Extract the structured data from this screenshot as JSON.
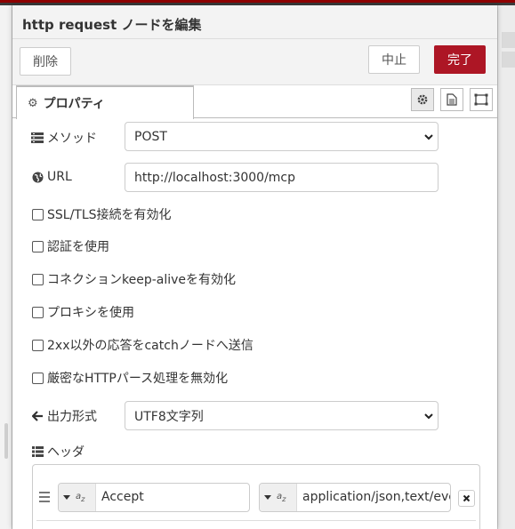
{
  "dialog": {
    "title": "http request ノードを編集",
    "delete_label": "削除",
    "cancel_label": "中止",
    "done_label": "完了"
  },
  "tabs": {
    "properties_label": "プロパティ",
    "icons": [
      "gear-icon",
      "description-icon",
      "appearance-icon"
    ]
  },
  "form": {
    "method": {
      "label": "メソッド",
      "value": "POST"
    },
    "url": {
      "label": "URL",
      "value": "http://localhost:3000/mcp"
    },
    "checkboxes": [
      "SSL/TLS接続を有効化",
      "認証を使用",
      "コネクションkeep-aliveを有効化",
      "プロキシを使用",
      "2xx以外の応答をcatchノードへ送信",
      "厳密なHTTPパース処理を無効化"
    ],
    "output": {
      "label": "出力形式",
      "value": "UTF8文字列"
    },
    "headers": {
      "label": "ヘッダ",
      "rows": [
        {
          "key": "Accept",
          "value": "application/json,text/event-s"
        }
      ]
    }
  },
  "colors": {
    "accent": "#ad1625",
    "topbar": "#8f0000"
  }
}
